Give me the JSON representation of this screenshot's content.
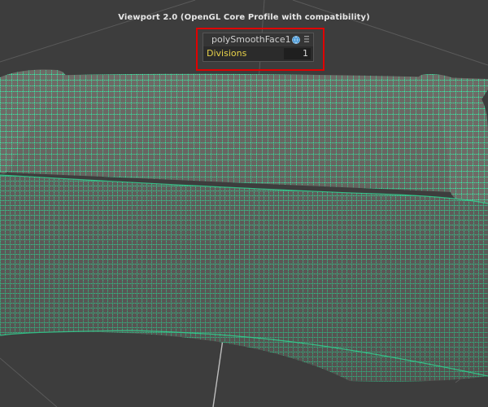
{
  "viewport": {
    "label": "Viewport 2.0 (OpenGL Core Profile with compatibility)"
  },
  "hud": {
    "node_name": "polySmoothFace1",
    "attribute_label": "Divisions",
    "attribute_value": "1",
    "icons": [
      "globe-icon",
      "menu-icon"
    ]
  },
  "colors": {
    "viewport_bg": "#3d3d3d",
    "mesh_surface": "#6e6a66",
    "wireframe": "#38f0a8",
    "attribute_label": "#e8d24a",
    "highlight_box": "#e00000"
  }
}
